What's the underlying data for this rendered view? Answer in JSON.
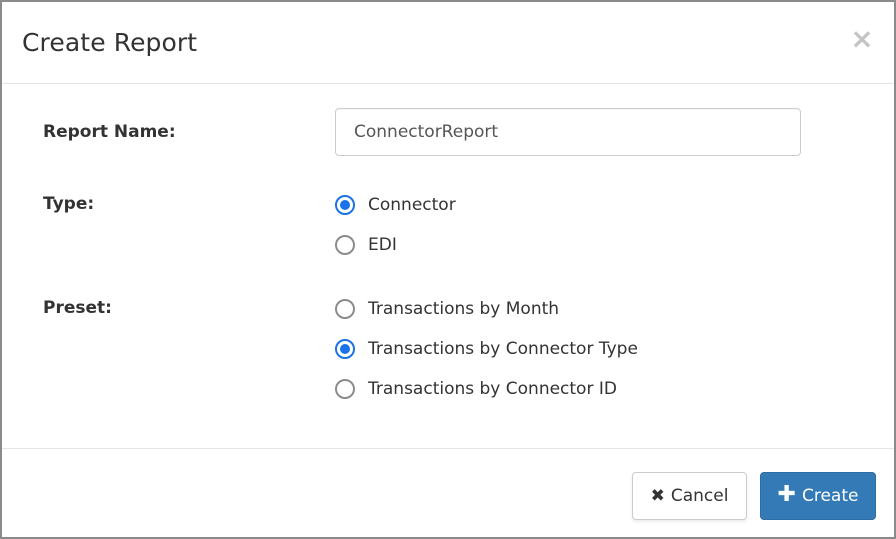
{
  "dialog": {
    "title": "Create Report",
    "close_glyph": "×"
  },
  "form": {
    "report_name": {
      "label": "Report Name:",
      "value": "ConnectorReport"
    },
    "type": {
      "label": "Type:",
      "options": [
        {
          "label": "Connector",
          "checked": true
        },
        {
          "label": "EDI",
          "checked": false
        }
      ]
    },
    "preset": {
      "label": "Preset:",
      "options": [
        {
          "label": "Transactions by Month",
          "checked": false
        },
        {
          "label": "Transactions by Connector Type",
          "checked": true
        },
        {
          "label": "Transactions by Connector ID",
          "checked": false
        }
      ]
    }
  },
  "footer": {
    "cancel": {
      "icon": "close-icon",
      "glyph": "✖",
      "label": "Cancel"
    },
    "create": {
      "icon": "plus-icon",
      "glyph": "✚",
      "label": "Create"
    }
  },
  "colors": {
    "primary": "#337ab7",
    "radio_checked": "#1a73e8",
    "close": "#c4c4c4"
  }
}
